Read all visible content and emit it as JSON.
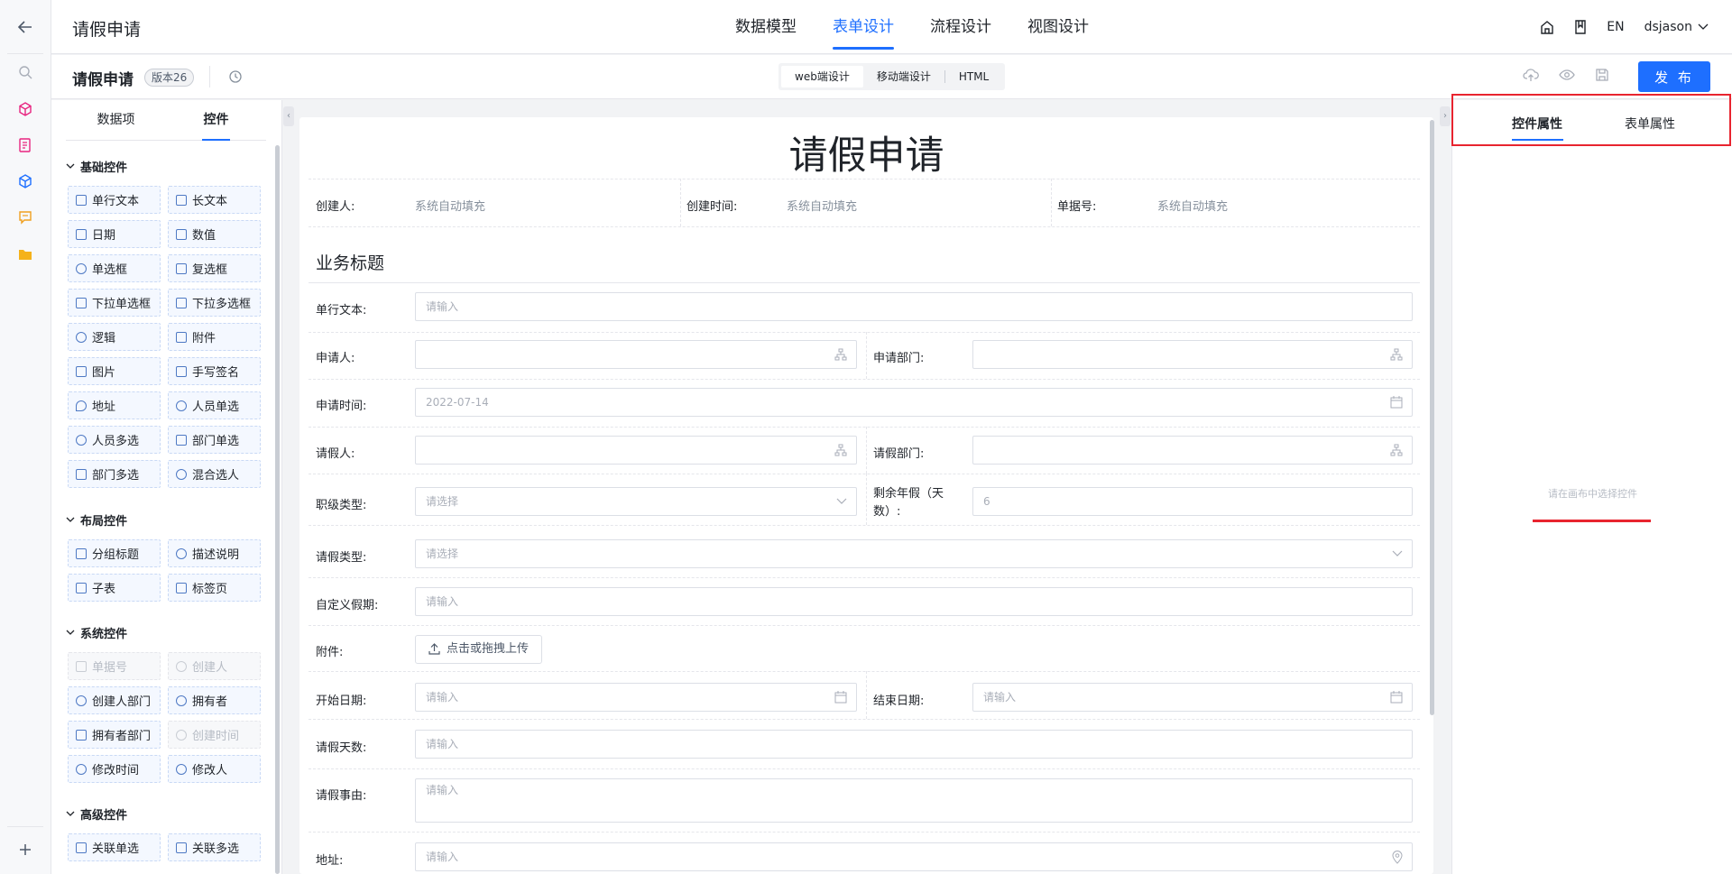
{
  "window": {
    "title": "请假申请"
  },
  "header": {
    "tabs": [
      {
        "label": "数据模型"
      },
      {
        "label": "表单设计",
        "active": true
      },
      {
        "label": "流程设计"
      },
      {
        "label": "视图设计"
      }
    ],
    "lang": "EN",
    "user": "dsjason",
    "icons": [
      "home-icon",
      "book-icon",
      "chevron-down-icon"
    ]
  },
  "subbar": {
    "form_name": "请假申请",
    "version": "版本26",
    "modes": [
      {
        "label": "web端设计",
        "active": true
      },
      {
        "label": "移动端设计"
      },
      {
        "label": "HTML"
      }
    ],
    "publish": "发 布",
    "icons": [
      "cloud-upload-icon",
      "eye-icon",
      "save-icon",
      "history-icon"
    ]
  },
  "left": {
    "tabs": [
      {
        "label": "数据项"
      },
      {
        "label": "控件",
        "active": true
      }
    ],
    "groups": [
      {
        "title": "基础控件",
        "items": [
          {
            "label": "单行文本"
          },
          {
            "label": "长文本"
          },
          {
            "label": "日期"
          },
          {
            "label": "数值"
          },
          {
            "label": "单选框"
          },
          {
            "label": "复选框"
          },
          {
            "label": "下拉单选框"
          },
          {
            "label": "下拉多选框"
          },
          {
            "label": "逻辑"
          },
          {
            "label": "附件"
          },
          {
            "label": "图片"
          },
          {
            "label": "手写签名"
          },
          {
            "label": "地址"
          },
          {
            "label": "人员单选"
          },
          {
            "label": "人员多选"
          },
          {
            "label": "部门单选"
          },
          {
            "label": "部门多选"
          },
          {
            "label": "混合选人"
          }
        ]
      },
      {
        "title": "布局控件",
        "items": [
          {
            "label": "分组标题"
          },
          {
            "label": "描述说明"
          },
          {
            "label": "子表"
          },
          {
            "label": "标签页"
          }
        ]
      },
      {
        "title": "系统控件",
        "items": [
          {
            "label": "单据号",
            "disabled": true
          },
          {
            "label": "创建人",
            "disabled": true
          },
          {
            "label": "创建人部门"
          },
          {
            "label": "拥有者"
          },
          {
            "label": "拥有者部门"
          },
          {
            "label": "创建时间",
            "disabled": true
          },
          {
            "label": "修改时间"
          },
          {
            "label": "修改人"
          }
        ]
      },
      {
        "title": "高级控件",
        "items": [
          {
            "label": "关联单选"
          },
          {
            "label": "关联多选"
          }
        ]
      }
    ]
  },
  "form": {
    "title": "请假申请",
    "meta": [
      {
        "label": "创建人:",
        "value": "系统自动填充"
      },
      {
        "label": "创建时间:",
        "value": "系统自动填充"
      },
      {
        "label": "单据号:",
        "value": "系统自动填充"
      }
    ],
    "section": "业务标题",
    "fields": {
      "single_text": {
        "label": "单行文本:",
        "placeholder": "请输入"
      },
      "applicant": {
        "label": "申请人:",
        "value": ""
      },
      "apply_dept": {
        "label": "申请部门:",
        "value": ""
      },
      "apply_time": {
        "label": "申请时间:",
        "value": "2022-07-14"
      },
      "leave_person": {
        "label": "请假人:",
        "value": ""
      },
      "leave_dept": {
        "label": "请假部门:",
        "value": ""
      },
      "rank_type": {
        "label": "职级类型:",
        "placeholder": "请选择"
      },
      "remaining": {
        "label_line1": "剩余年假（天",
        "label_line2": "数）:",
        "value": "6"
      },
      "leave_type": {
        "label": "请假类型:",
        "placeholder": "请选择"
      },
      "custom_period": {
        "label": "自定义假期:",
        "placeholder": "请输入"
      },
      "attachment": {
        "label": "附件:",
        "button": "点击或拖拽上传"
      },
      "start_date": {
        "label": "开始日期:",
        "placeholder": "请输入"
      },
      "end_date": {
        "label": "结束日期:",
        "placeholder": "请输入"
      },
      "leave_days": {
        "label": "请假天数:",
        "placeholder": "请输入"
      },
      "reason": {
        "label": "请假事由:",
        "placeholder": "请输入"
      },
      "address": {
        "label": "地址:",
        "placeholder": "请输入"
      }
    }
  },
  "right": {
    "tabs": [
      {
        "label": "控件属性",
        "active": true
      },
      {
        "label": "表单属性"
      }
    ],
    "empty_hint": "请在画布中选择控件"
  },
  "colors": {
    "accent": "#1e6fff",
    "highlight": "#e8242f"
  }
}
